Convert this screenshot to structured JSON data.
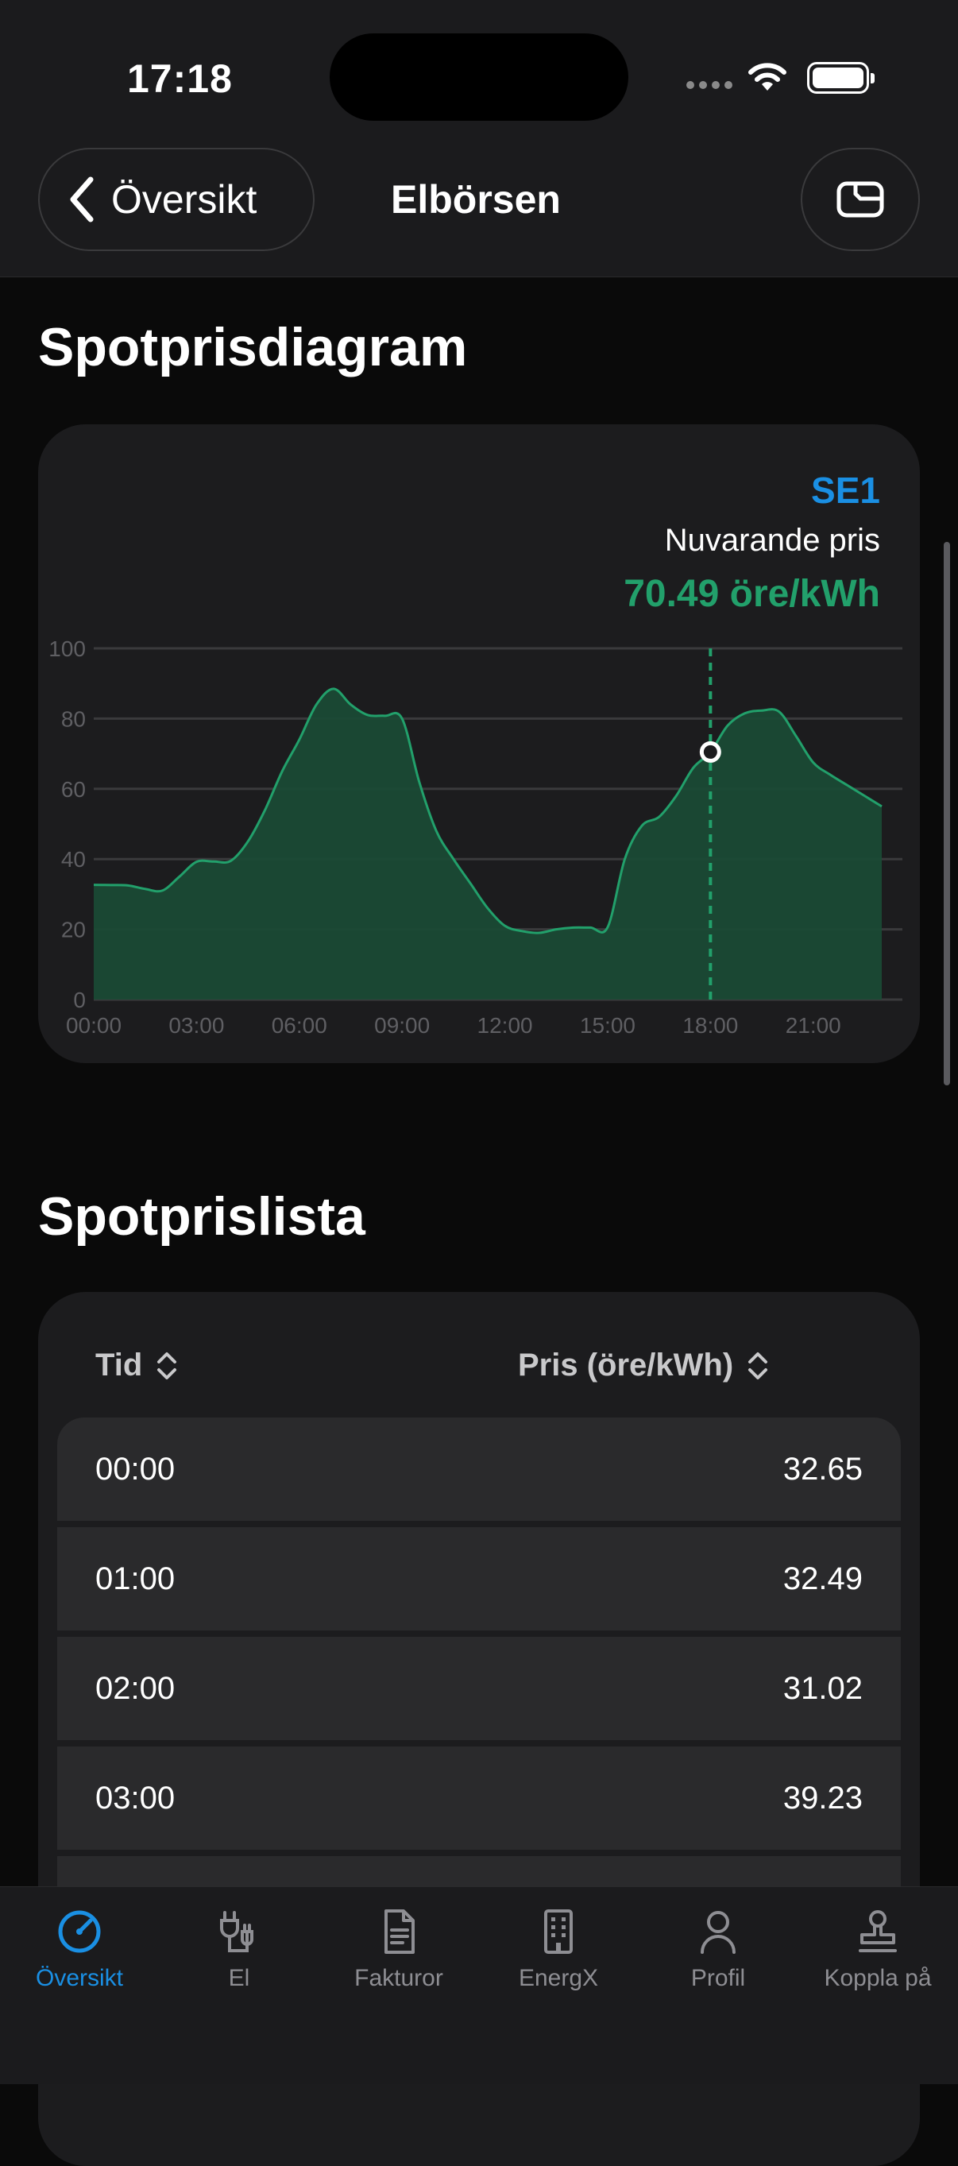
{
  "status": {
    "time": "17:18"
  },
  "header": {
    "back_label": "Översikt",
    "title": "Elbörsen"
  },
  "chart_section": {
    "title": "Spotprisdiagram",
    "region": "SE1",
    "current_label": "Nuvarande pris",
    "current_value": "70.49 öre/kWh"
  },
  "chart_data": {
    "type": "area",
    "x": [
      "00:00",
      "00:30",
      "01:00",
      "01:30",
      "02:00",
      "02:30",
      "03:00",
      "03:30",
      "04:00",
      "04:30",
      "05:00",
      "05:30",
      "06:00",
      "06:30",
      "07:00",
      "07:30",
      "08:00",
      "08:30",
      "09:00",
      "09:30",
      "10:00",
      "10:30",
      "11:00",
      "11:30",
      "12:00",
      "12:30",
      "13:00",
      "13:30",
      "14:00",
      "14:30",
      "15:00",
      "15:30",
      "16:00",
      "16:30",
      "17:00",
      "17:30",
      "18:00",
      "18:30",
      "19:00",
      "19:30",
      "20:00",
      "20:30",
      "21:00",
      "21:30",
      "22:00",
      "22:30",
      "23:00"
    ],
    "values": [
      32.65,
      32.6,
      32.49,
      31.5,
      31.02,
      35,
      39.23,
      39.3,
      39.5,
      45,
      54,
      65,
      74,
      84,
      88.5,
      84,
      81,
      80.8,
      80,
      62,
      48,
      40,
      33,
      26,
      21,
      19.5,
      19,
      20,
      20.5,
      20.5,
      20.6,
      40,
      49.5,
      52,
      58,
      66,
      70.49,
      78,
      81.5,
      82.3,
      82,
      75,
      67.5,
      64,
      61,
      58,
      55
    ],
    "x_ticks": [
      "00:00",
      "03:00",
      "06:00",
      "09:00",
      "12:00",
      "15:00",
      "18:00",
      "21:00"
    ],
    "y_ticks": [
      "0",
      "20",
      "40",
      "60",
      "80",
      "100"
    ],
    "ylim": [
      0,
      100
    ],
    "current_time": "18:00",
    "current_value": 70.49,
    "grid": true,
    "colors": {
      "line": "#22a06b",
      "fill": "#1a4a35",
      "grid": "#3a3a3c",
      "axis_text": "#5f5f63",
      "region": "#1a8fe3"
    }
  },
  "list_section": {
    "title": "Spotprislista",
    "col_time": "Tid",
    "col_price": "Pris (öre/kWh)",
    "rows": [
      {
        "time": "00:00",
        "price": "32.65"
      },
      {
        "time": "01:00",
        "price": "32.49"
      },
      {
        "time": "02:00",
        "price": "31.02"
      },
      {
        "time": "03:00",
        "price": "39.23"
      },
      {
        "time": "",
        "price": ""
      }
    ]
  },
  "tabbar": {
    "items": [
      {
        "label": "Översikt",
        "icon": "gauge-icon"
      },
      {
        "label": "El",
        "icon": "plug-icon"
      },
      {
        "label": "Fakturor",
        "icon": "document-icon"
      },
      {
        "label": "EnergX",
        "icon": "building-icon"
      },
      {
        "label": "Profil",
        "icon": "person-icon"
      },
      {
        "label": "Koppla på",
        "icon": "stamp-icon"
      }
    ]
  }
}
